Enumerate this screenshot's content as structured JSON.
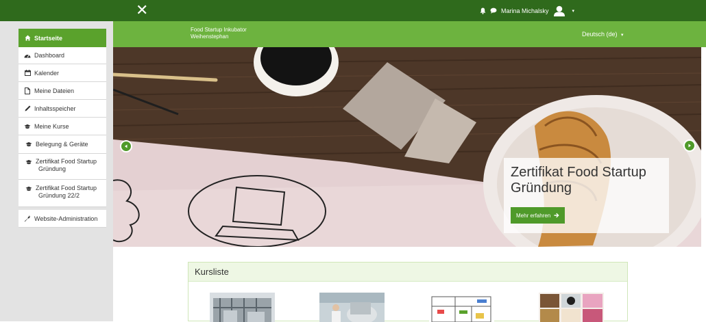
{
  "topbar": {
    "close_symbol": "✕",
    "user_name": "Marina Michalsky",
    "icons": [
      "bell-icon",
      "chat-icon",
      "avatar-icon",
      "caret-down-icon"
    ],
    "bg_color": "#2f6a1c"
  },
  "header": {
    "site_line1": "Food Startup Inkubator",
    "site_line2": "Weihenstephan",
    "language": "Deutsch (de)",
    "language_caret": "▾",
    "bg_color": "#6db33f"
  },
  "sidebar": {
    "items": [
      {
        "label": "Startseite",
        "icon": "home-icon"
      },
      {
        "label": "Dashboard",
        "icon": "dashboard-icon"
      },
      {
        "label": "Kalender",
        "icon": "calendar-icon"
      },
      {
        "label": "Meine Dateien",
        "icon": "file-icon"
      },
      {
        "label": "Inhaltsspeicher",
        "icon": "pencil-icon"
      },
      {
        "label": "Meine Kurse",
        "icon": "graduation-cap-icon"
      },
      {
        "label": "Belegung & Geräte",
        "icon": "graduation-cap-icon"
      },
      {
        "label_line1": "Zertifikat Food Startup",
        "label_line2": "Gründung",
        "icon": "graduation-cap-icon"
      },
      {
        "label_line1": "Zertifikat Food Startup",
        "label_line2": "Gründung 22/2",
        "icon": "graduation-cap-icon"
      },
      {
        "label": "Website-Administration",
        "icon": "wrench-icon"
      }
    ],
    "accent_color": "#5aa22c"
  },
  "slider": {
    "caption_title": "Zertifikat Food Startup Gründung",
    "button_label": "Mehr erfahren",
    "button_icon": "arrow-right-icon"
  },
  "courses": {
    "heading": "Kursliste",
    "thumbnails": [
      "factory-thumbnail",
      "lab-thumbnail",
      "floorplan-thumbnail",
      "food-collage-thumbnail"
    ]
  }
}
